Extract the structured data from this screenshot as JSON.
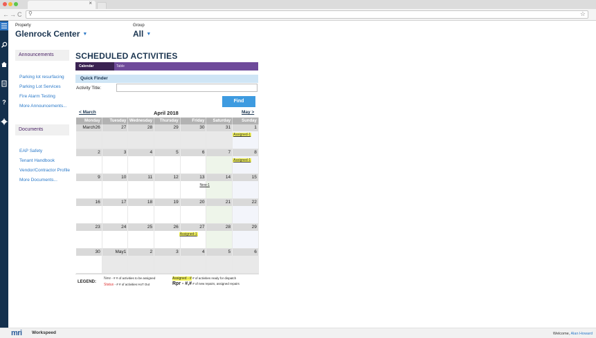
{
  "browser": {
    "tab_close": "×",
    "search_glyph": "⚲",
    "star_glyph": "☆",
    "back_glyph": "←",
    "fwd_glyph": "→",
    "reload_glyph": "C"
  },
  "header": {
    "property_label": "Property",
    "property_value": "Glenrock Center",
    "group_label": "Group",
    "group_value": "All"
  },
  "sidebar": {
    "announcements_title": "Announcements",
    "announcements": [
      "Parking lot resurfacing",
      "Parking Lot Services",
      "Fire Alarm Testing",
      "More Announcements..."
    ],
    "documents_title": "Documents",
    "documents": [
      "EAP Safety",
      "Tenant Handbook",
      "Vendor/Contractor Profile",
      "More Documents..."
    ]
  },
  "main": {
    "title": "SCHEDULED ACTIVITIES",
    "tabs": [
      "Calendar",
      "Table"
    ],
    "quick_finder": "Quick Finder",
    "activity_title_label": "Activity Title:",
    "activity_title_value": "",
    "find_label": "Find",
    "prev_month": "< March",
    "next_month": "May >",
    "month_title": "April  2018"
  },
  "calendar": {
    "days": [
      "Monday",
      "Tuesday",
      "Wednesday",
      "Thursday",
      "Friday",
      "Saturday",
      "Sunday"
    ],
    "weeks": [
      [
        "March26",
        "27",
        "28",
        "29",
        "30",
        "31",
        "1"
      ],
      [
        "2",
        "3",
        "4",
        "5",
        "6",
        "7",
        "8"
      ],
      [
        "9",
        "10",
        "11",
        "12",
        "13",
        "14",
        "15"
      ],
      [
        "16",
        "17",
        "18",
        "19",
        "20",
        "21",
        "22"
      ],
      [
        "23",
        "24",
        "25",
        "26",
        "27",
        "28",
        "29"
      ],
      [
        "30",
        "May1",
        "2",
        "3",
        "4",
        "5",
        "6"
      ]
    ],
    "entries": {
      "w0_sun": "Assigned-1",
      "w1_sun": "Assigned-1",
      "w2_sat": "New-1",
      "w4_fri": "Assigned-1"
    }
  },
  "legend": {
    "title": "LEGEND:",
    "new_label": "New",
    "new_desc": "- # # of activities to be assigned",
    "status_label": "Status",
    "status_desc": "- # # of activities HoT Out",
    "assigned_label": "Assigned - #",
    "assigned_desc": "# of activities ready for dispatch",
    "rpr_label": "Rpr - #,#",
    "rpr_desc": "# of new repairs, assigned repairs"
  },
  "footer": {
    "logo": "mri",
    "product": "Workspeed",
    "welcome": "Welcome,",
    "user": "Alan Howard"
  },
  "colors": {
    "rail": "#14304d",
    "accent": "#2f7ac7",
    "tab_purple": "#6e4a9a",
    "quick_finder_bg": "#cfe5f5",
    "assigned_highlight": "#f3f35a"
  }
}
